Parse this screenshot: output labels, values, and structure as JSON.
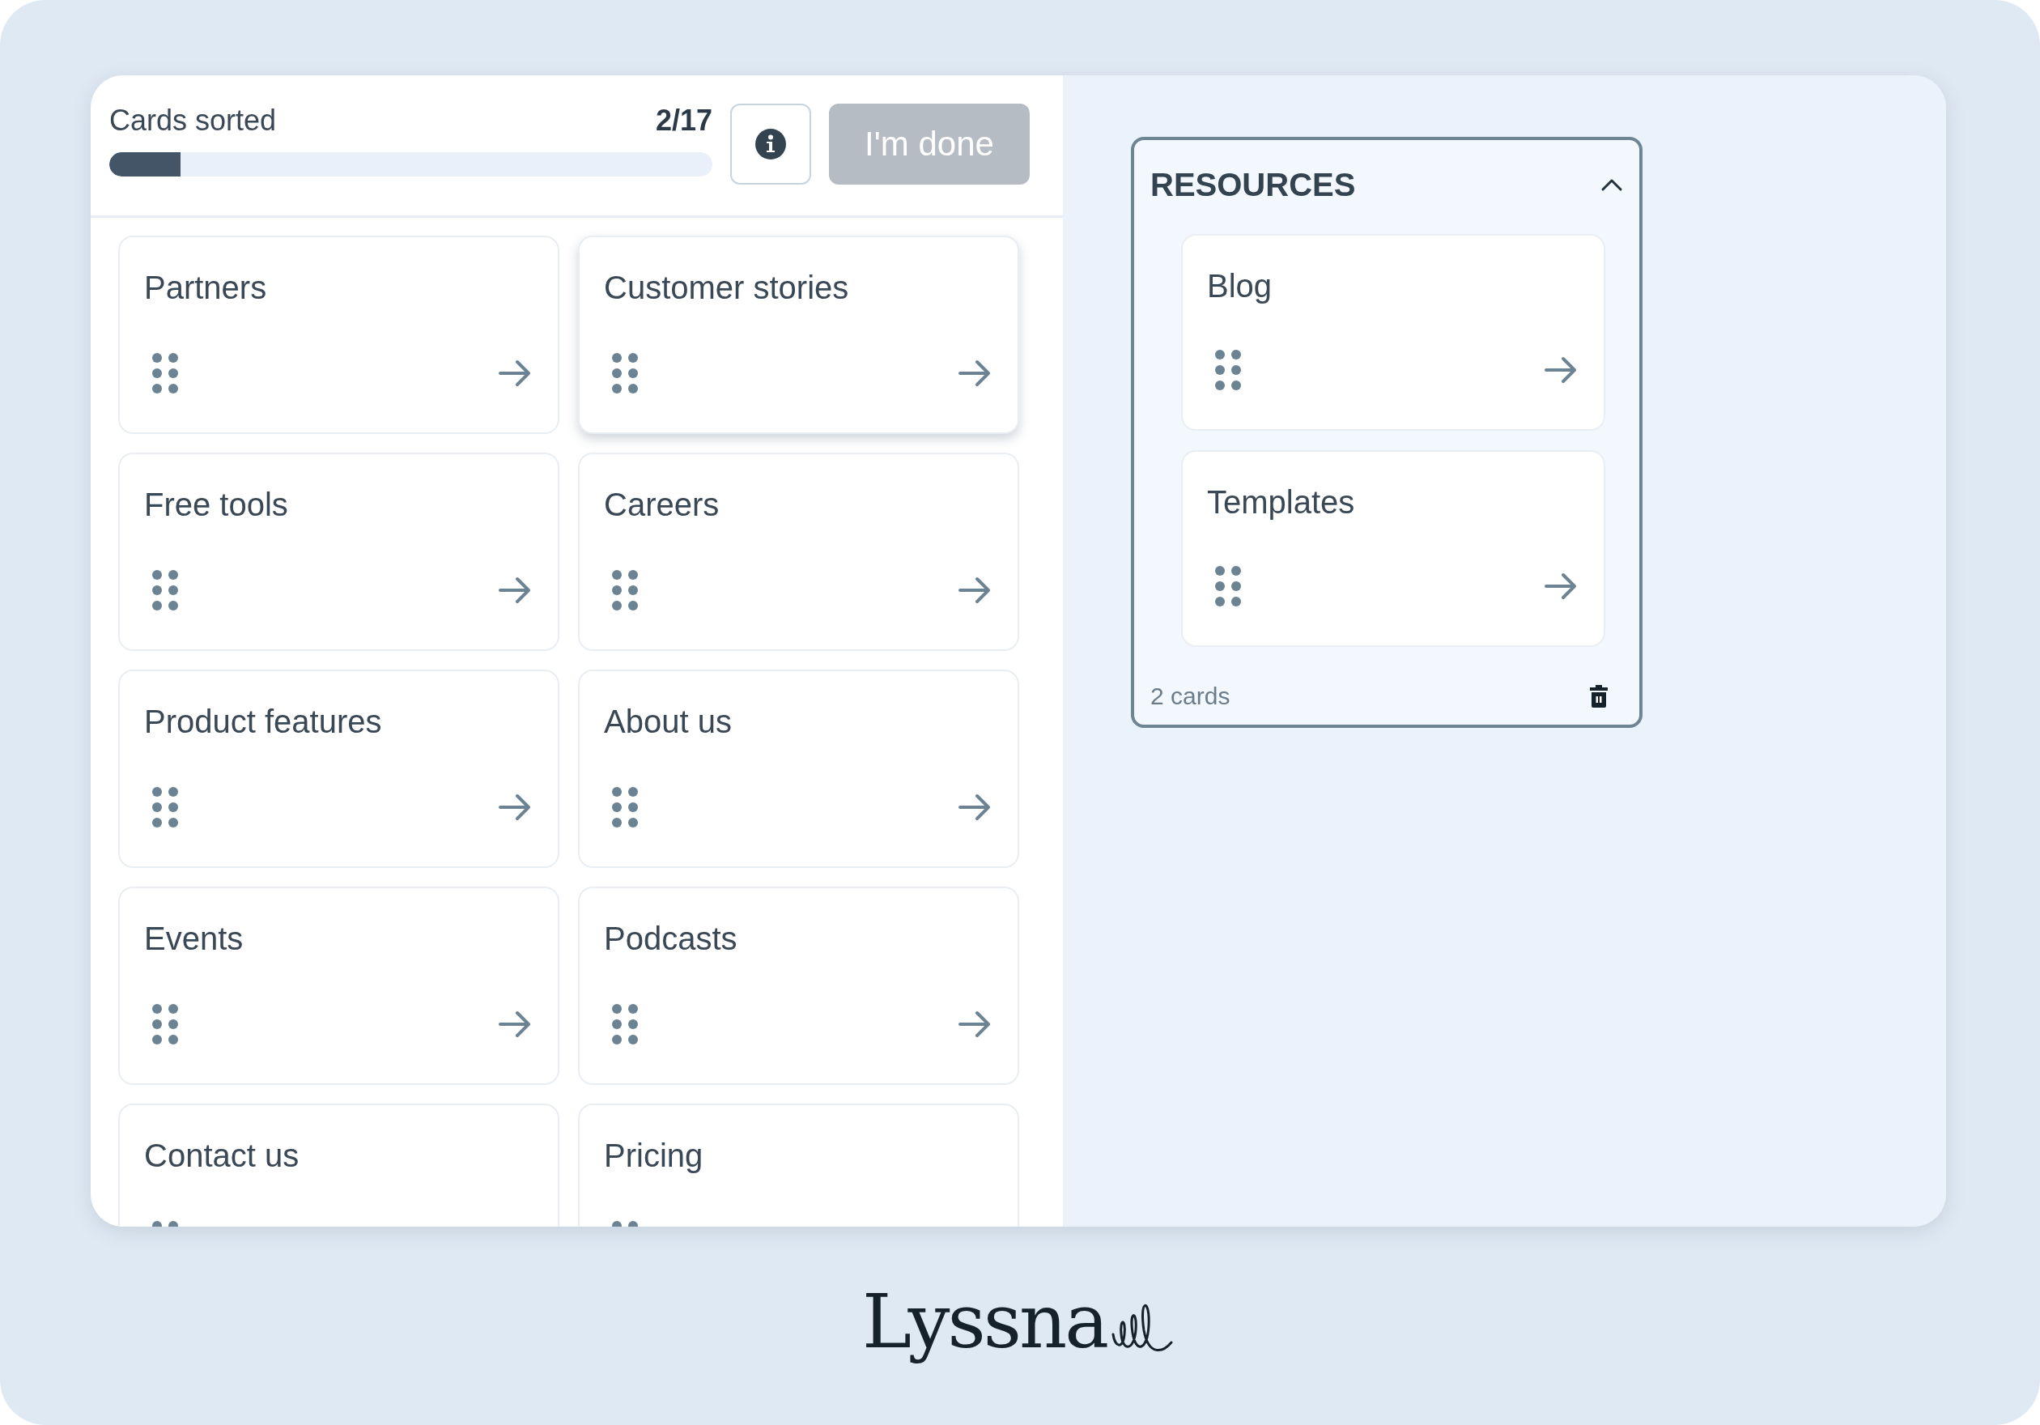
{
  "progress": {
    "label": "Cards sorted",
    "count": "2/17",
    "level": 0.118
  },
  "done_button": {
    "label": "I'm done",
    "disabled": true
  },
  "cards": [
    {
      "title": "Partners",
      "lifted": false
    },
    {
      "title": "Customer stories",
      "lifted": true
    },
    {
      "title": "Free tools",
      "lifted": false
    },
    {
      "title": "Careers",
      "lifted": false
    },
    {
      "title": "Product features",
      "lifted": false
    },
    {
      "title": "About us",
      "lifted": false
    },
    {
      "title": "Events",
      "lifted": false
    },
    {
      "title": "Podcasts",
      "lifted": false
    },
    {
      "title": "Contact us",
      "lifted": false
    },
    {
      "title": "Pricing",
      "lifted": false
    }
  ],
  "categories": [
    {
      "title": "RESOURCES",
      "expanded": true,
      "cards": [
        {
          "title": "Blog"
        },
        {
          "title": "Templates"
        }
      ],
      "count": "2 cards"
    }
  ],
  "logo": "Lyssna"
}
